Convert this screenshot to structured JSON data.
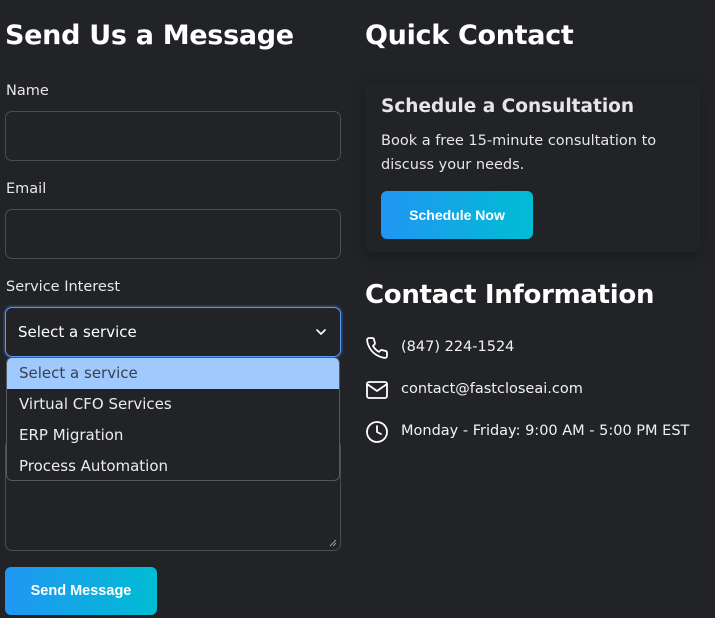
{
  "form": {
    "title": "Send Us a Message",
    "name_label": "Name",
    "name_value": "",
    "email_label": "Email",
    "email_value": "",
    "service_label": "Service Interest",
    "service_value": "Select a service",
    "service_options": [
      "Select a service",
      "Virtual CFO Services",
      "ERP Migration",
      "Process Automation"
    ],
    "message_value": "",
    "submit_label": "Send Message"
  },
  "quick_contact": {
    "title": "Quick Contact",
    "card": {
      "title": "Schedule a Consultation",
      "text": "Book a free 15-minute consultation to discuss your needs.",
      "button_label": "Schedule Now"
    }
  },
  "contact_info": {
    "title": "Contact Information",
    "phone": "(847) 224-1524",
    "email": "contact@fastcloseai.com",
    "hours": "Monday - Friday: 9:00 AM - 5:00 PM EST"
  },
  "colors": {
    "background": "#212327",
    "accent_start": "#2196f3",
    "accent_end": "#00bcd4",
    "highlight": "#9fc9ff",
    "focus_border": "#5b9bf5"
  },
  "icons": [
    "chevron-down-icon",
    "phone-icon",
    "mail-icon",
    "clock-icon",
    "resize-handle-icon"
  ]
}
